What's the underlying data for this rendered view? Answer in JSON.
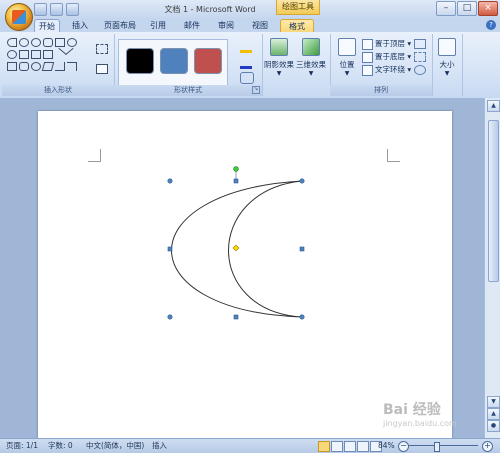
{
  "window": {
    "title": "文档 1 - Microsoft Word",
    "context_tool": "绘图工具",
    "controls": [
      "–",
      "□",
      "×"
    ]
  },
  "tabs": [
    {
      "label": "开始",
      "active": true
    },
    {
      "label": "插入"
    },
    {
      "label": "页面布局"
    },
    {
      "label": "引用"
    },
    {
      "label": "邮件"
    },
    {
      "label": "审阅"
    },
    {
      "label": "视图"
    },
    {
      "label": "格式",
      "contextual": true
    }
  ],
  "ribbon": {
    "insert_shapes_label": "插入形状",
    "shape_styles_label": "形状样式",
    "arrange_label": "排列",
    "shadow_effect": "阴影效果",
    "threed_effect": "三维效果",
    "position": "位置",
    "bring_front": "置于顶层",
    "send_back": "置于底层",
    "text_wrap": "文字环绕",
    "size": "大小",
    "swatch_colors": [
      "#000000",
      "#4f81bd",
      "#c0504d"
    ]
  },
  "statusbar": {
    "page": "页面: 1/1",
    "words": "字数: 0",
    "language": "中文(简体，中国)",
    "insert_mode": "插入",
    "zoom": "84%"
  },
  "watermark": {
    "main": "Bai 经验",
    "sub": "jingyan.baidu.com"
  }
}
